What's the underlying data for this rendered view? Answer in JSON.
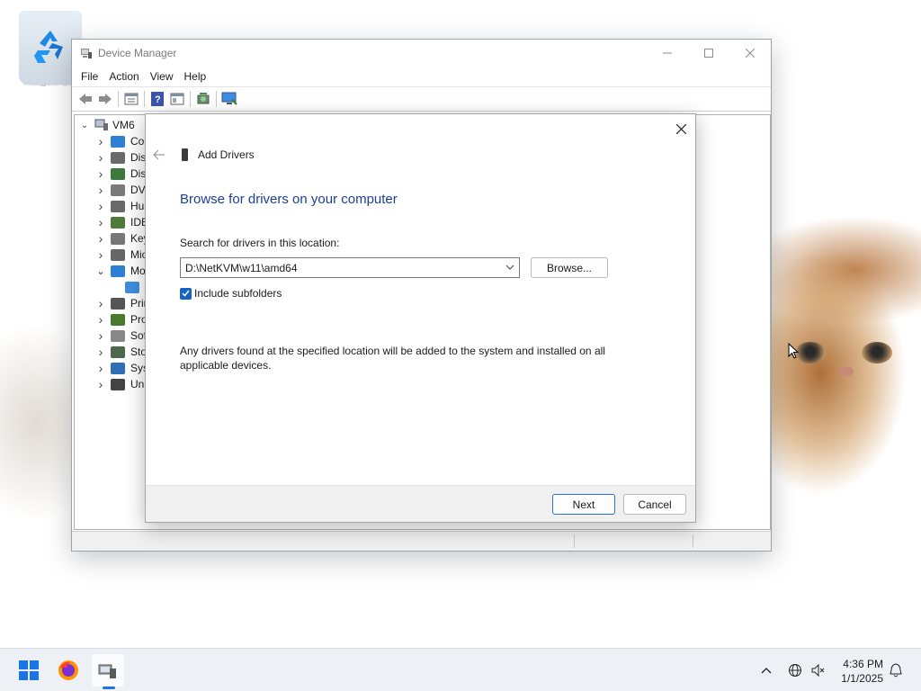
{
  "desktop": {
    "recycle_bin_label": "Recycle Bin"
  },
  "device_manager": {
    "title": "Device Manager",
    "menu": [
      "File",
      "Action",
      "View",
      "Help"
    ],
    "tree_root": "VM6",
    "tree_items": [
      {
        "label": "Cor",
        "icon": "computer-icon",
        "color": "#2f7fd6",
        "expanded": false
      },
      {
        "label": "Disk",
        "icon": "disk-drive-icon",
        "color": "#6a6a6a",
        "expanded": false
      },
      {
        "label": "Disp",
        "icon": "display-adapter-icon",
        "color": "#3b7a3b",
        "expanded": false
      },
      {
        "label": "DVD",
        "icon": "dvd-drive-icon",
        "color": "#7a7a7a",
        "expanded": false
      },
      {
        "label": "Hun",
        "icon": "hid-icon",
        "color": "#6a6a6a",
        "expanded": false
      },
      {
        "label": "IDE",
        "icon": "ide-controller-icon",
        "color": "#4f7a3a",
        "expanded": false
      },
      {
        "label": "Key",
        "icon": "keyboard-icon",
        "color": "#777777",
        "expanded": false
      },
      {
        "label": "Mic",
        "icon": "mouse-icon",
        "color": "#666666",
        "expanded": false
      },
      {
        "label": "Mo",
        "icon": "monitor-icon",
        "color": "#2f7fd6",
        "expanded": true
      },
      {
        "label": "",
        "icon": "monitor-child-icon",
        "color": "#3d8ee0",
        "expanded": null
      },
      {
        "label": "Prin",
        "icon": "print-queue-icon",
        "color": "#555555",
        "expanded": false
      },
      {
        "label": "Pro",
        "icon": "processor-icon",
        "color": "#4a7a2e",
        "expanded": false
      },
      {
        "label": "Soft",
        "icon": "software-device-icon",
        "color": "#888888",
        "expanded": false
      },
      {
        "label": "Stor",
        "icon": "storage-controller-icon",
        "color": "#4a6a4a",
        "expanded": false
      },
      {
        "label": "Syst",
        "icon": "system-device-icon",
        "color": "#2f6fb6",
        "expanded": false
      },
      {
        "label": "Uni",
        "icon": "usb-icon",
        "color": "#444444",
        "expanded": false
      }
    ]
  },
  "dialog": {
    "header": "Add Drivers",
    "heading": "Browse for drivers on your computer",
    "search_label": "Search for drivers in this location:",
    "path_value": "D:\\NetKVM\\w11\\amd64",
    "browse_label": "Browse...",
    "include_subfolders_label": "Include subfolders",
    "include_subfolders_checked": true,
    "info_text": "Any drivers found at the specified location will be added to the system and installed on all applicable devices.",
    "next_label": "Next",
    "cancel_label": "Cancel"
  },
  "taskbar": {
    "time": "4:36 PM",
    "date": "1/1/2025"
  },
  "colors": {
    "heading_blue": "#1c3f94",
    "checkbox_blue": "#1963c0",
    "taskbar_bg": "#edf1f6"
  }
}
